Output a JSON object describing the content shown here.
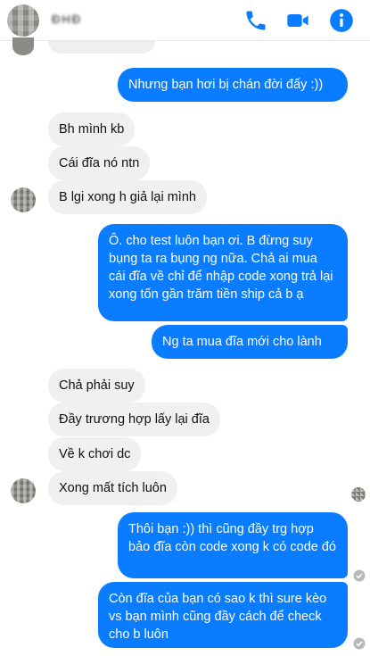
{
  "header": {
    "contact_name": "ĐHĐ",
    "icons": [
      "phone-icon",
      "video-call-icon",
      "info-icon"
    ],
    "accent": "#0a7cff"
  },
  "colors": {
    "outgoing": "#0a7cff",
    "incoming": "#f0f0f0"
  },
  "messages": [
    {
      "from": "me",
      "text": "Nhưng bạn hơi bị chán đời đấy :))"
    },
    {
      "from": "them",
      "text": "Bh mình kb"
    },
    {
      "from": "them",
      "text": "Cái đĩa nó ntn"
    },
    {
      "from": "them",
      "text": "B lgi xong h giả lại mình"
    },
    {
      "from": "me",
      "text": "Ô. cho test luôn bạn ơi. B đừng suy bụng ta ra bụng ng nữa. Chả ai mua cái đĩa về chỉ để nhập code xong trả lại xong tốn gần trăm tiền ship cả b ạ"
    },
    {
      "from": "me",
      "text": "Ng ta mua đĩa mới cho lành"
    },
    {
      "from": "them",
      "text": "Chả phải suy"
    },
    {
      "from": "them",
      "text": "Đầy trương hợp lấy lại đĩa"
    },
    {
      "from": "them",
      "text": "Về k chơi dc"
    },
    {
      "from": "them",
      "text": "Xong mất tích luôn"
    },
    {
      "from": "me",
      "text": "Thôi bạn :)) thì cũng đầy trg hợp bảo đĩa còn code xong k có code đó"
    },
    {
      "from": "me",
      "text": "Còn đĩa của bạn có sao k thì sure kèo vs bạn mình cũng đầy cách để check cho b luôn"
    }
  ]
}
